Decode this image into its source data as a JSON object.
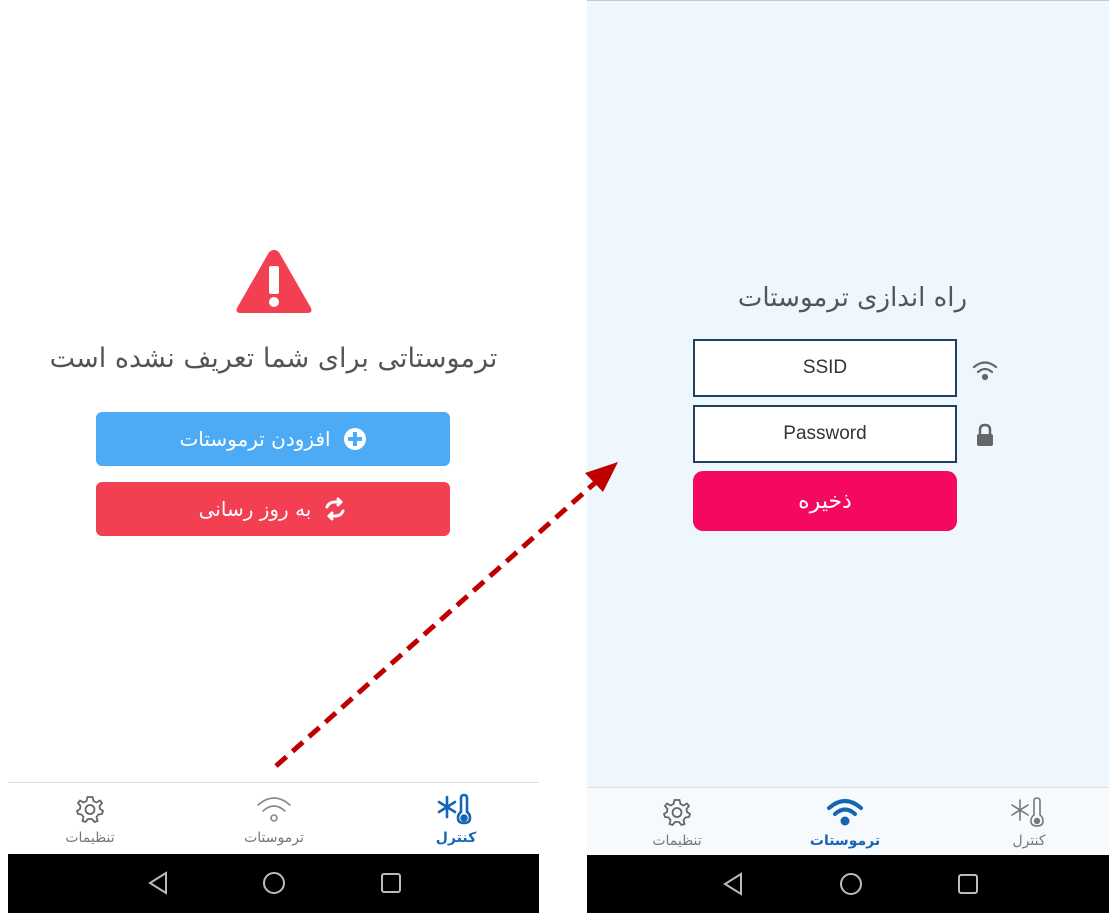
{
  "left_screen": {
    "message": "ترموستاتی برای شما تعریف نشده است",
    "add_button_label": "افزودن ترموستات",
    "refresh_button_label": "به روز رسانی"
  },
  "right_screen": {
    "title": "راه اندازی ترموستات",
    "ssid_placeholder": "SSID",
    "password_placeholder": "Password",
    "save_label": "ذخیره"
  },
  "nav": {
    "settings_label": "تنظیمات",
    "thermostats_label": "ترموستات",
    "control_label": "کنترل"
  },
  "left_active_tab": "control",
  "right_active_tab": "thermostats",
  "icons": [
    "warning-icon",
    "plus-circle-icon",
    "refresh-icon",
    "wifi-icon",
    "lock-icon",
    "gear-icon",
    "snowflake-thermometer-icon",
    "back-icon",
    "home-icon",
    "recents-icon"
  ],
  "colors": {
    "add_button": "#4dabf5",
    "refresh_button": "#f23f52",
    "save_button": "#f5085f",
    "active_nav": "#1565b5",
    "arrow": "#c00000"
  }
}
